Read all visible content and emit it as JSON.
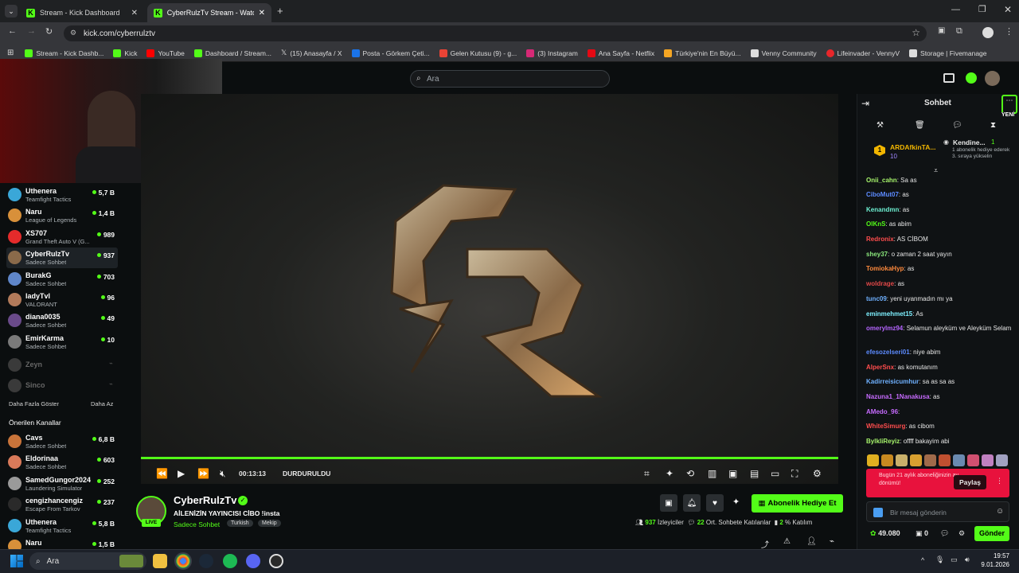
{
  "browser": {
    "tabs": [
      {
        "title": "Stream - Kick Dashboard"
      },
      {
        "title": "CyberRulzTv Stream - Watch Li"
      }
    ],
    "url": "kick.com/cyberrulztv",
    "bookmarks": [
      {
        "label": "Stream - Kick Dashb...",
        "color": "#53fc18"
      },
      {
        "label": "Kick",
        "color": "#53fc18"
      },
      {
        "label": "YouTube",
        "color": "#ff0000"
      },
      {
        "label": "Dashboard / Stream...",
        "color": "#53fc18"
      },
      {
        "label": "(15) Anasayfa / X",
        "color": "#ffffff"
      },
      {
        "label": "Posta - Görkem Çeti...",
        "color": "#1a73e8"
      },
      {
        "label": "Gelen Kutusu (9) - g...",
        "color": "#ea4335"
      },
      {
        "label": "(3) Instagram",
        "color": "#d62976"
      },
      {
        "label": "Ana Sayfa - Netflix",
        "color": "#e50914"
      },
      {
        "label": "Türkiye'nin En Büyü...",
        "color": "#f5a623"
      },
      {
        "label": "Venny Community",
        "color": "#ffffff"
      },
      {
        "label": "Lifeinvader - VennyV",
        "color": "#e8262a"
      },
      {
        "label": "Storage | Fivemanage",
        "color": "#ffffff"
      }
    ]
  },
  "search": {
    "placeholder": "Ara"
  },
  "sidebar": {
    "following": [
      {
        "name": "Uthenera",
        "game": "Teamfight Tactics",
        "viewers": "5,7 B",
        "color": "#3aa7d8"
      },
      {
        "name": "Naru",
        "game": "League of Legends",
        "viewers": "1,4 B",
        "color": "#d8903a"
      },
      {
        "name": "XS707",
        "game": "Grand Theft Auto V (G...",
        "viewers": "989",
        "color": "#e52b2b"
      },
      {
        "name": "CyberRulzTv",
        "game": "Sadece Sohbet",
        "viewers": "937",
        "color": "#8a6a4a"
      },
      {
        "name": "BurakG",
        "game": "Sadece Sohbet",
        "viewers": "703",
        "color": "#5f86c9"
      },
      {
        "name": "ladyTvl",
        "game": "VALORANT",
        "viewers": "96",
        "color": "#b27a5a"
      },
      {
        "name": "diana0035",
        "game": "Sadece Sohbet",
        "viewers": "49",
        "color": "#6a4a8a"
      },
      {
        "name": "EmirKarma",
        "game": "Sadece Sohbet",
        "viewers": "10",
        "color": "#7a7a7a"
      }
    ],
    "offline": [
      {
        "name": "Zeyn"
      },
      {
        "name": "Sinco"
      }
    ],
    "show_more": "Daha Fazla Göster",
    "show_less": "Daha Az",
    "recommended_title": "Önerilen Kanallar",
    "recommended": [
      {
        "name": "Cavs",
        "game": "Sadece Sohbet",
        "viewers": "6,8 B",
        "color": "#c9743a"
      },
      {
        "name": "Eldorinaa",
        "game": "Sadece Sohbet",
        "viewers": "603",
        "color": "#d97a5a"
      },
      {
        "name": "SamedGungor2024",
        "game": "Laundering Simulator",
        "viewers": "252",
        "color": "#9a9a9a"
      },
      {
        "name": "cengizhancengiz",
        "game": "Escape From Tarkov",
        "viewers": "237",
        "color": "#2a2a2a"
      },
      {
        "name": "Uthenera",
        "game": "Teamfight Tactics",
        "viewers": "5,8 B",
        "color": "#3aa7d8"
      },
      {
        "name": "Naru",
        "game": "",
        "viewers": "1,5 B",
        "color": "#d8903a"
      }
    ]
  },
  "player": {
    "time": "00:13:13",
    "status": "DURDURULDU"
  },
  "stream": {
    "channel": "CyberRulzTv",
    "title": "AİLENİZİN YAYINCISI CİBO !insta",
    "category": "Sadece Sohbet",
    "tags": [
      "Turkish",
      "Mekip"
    ],
    "live_badge": "LIVE",
    "subscribe_gift": "Abonelik Hediye Et",
    "viewers": "937",
    "viewers_label": "İzleyiciler",
    "avg_chatters": "22",
    "avg_label": "Ort. Sohbete Katılanlar",
    "participation": "2",
    "participation_label": "% Katılım"
  },
  "chat": {
    "title": "Sohbet",
    "new_label": "YENİ",
    "leader": {
      "rank": "1",
      "name": "ARDAfkinTA...",
      "count": "10"
    },
    "gift_event": {
      "name": "Kendine...",
      "count": "1",
      "text": "1 abonelik hediye ederek 3. sıraya yükselin"
    },
    "messages": [
      {
        "user": "Onii_cahn",
        "text": "Sa as",
        "color": "#a6f36b"
      },
      {
        "user": "CiboMut07",
        "text": "as",
        "color": "#5c8bff"
      },
      {
        "user": "Kenandmn",
        "text": "as",
        "color": "#6ef0d2"
      },
      {
        "user": "OlKnS",
        "text": "as abim",
        "color": "#53fc18"
      },
      {
        "user": "Redronix",
        "text": "AS CİBOM",
        "color": "#ff4d4d"
      },
      {
        "user": "shey37",
        "text": "o zaman 2 saat yayın",
        "color": "#8ae67c"
      },
      {
        "user": "TomiokaHyp",
        "text": "as",
        "color": "#ff8a3d"
      },
      {
        "user": "woldrage",
        "text": "as",
        "color": "#e04848"
      },
      {
        "user": "tunc09",
        "text": "yeni uyanmadın mı ya",
        "color": "#6fb1ff"
      },
      {
        "user": "eminmehmet15",
        "text": "As",
        "color": "#7ef0ff"
      },
      {
        "user": "omerylmz94",
        "text": "Selamun aleyküm ve Aleyküm Selam",
        "color": "#b565ff"
      },
      {
        "user": "efesozelseri01",
        "text": "niye abim",
        "color": "#5c8bff"
      },
      {
        "user": "AlperSnx",
        "text": "as komutanım",
        "color": "#ff4d4d"
      },
      {
        "user": "Kadirreisicumhur",
        "text": "sa as sa as",
        "color": "#6fb1ff"
      },
      {
        "user": "Nazuna1_1Nanakusa",
        "text": "as",
        "color": "#c76bff"
      },
      {
        "user": "AMedo_96",
        "text": "",
        "color": "#c76bff"
      },
      {
        "user": "WhiteSimurg",
        "text": "as cibom",
        "color": "#ff4d4d"
      },
      {
        "user": "BylkliReyiz",
        "text": "offff bakayim abi",
        "color": "#a6f36b"
      }
    ],
    "sub_banner": "Bugün 21 aylık aboneliğinizin ay dönümü!",
    "share": "Paylaş",
    "input_placeholder": "Bir mesaj gönderin",
    "points": "49.080",
    "zero": "0",
    "send": "Gönder"
  },
  "taskbar": {
    "search": "Ara",
    "time": "19:57",
    "date": "9.01.2026"
  }
}
